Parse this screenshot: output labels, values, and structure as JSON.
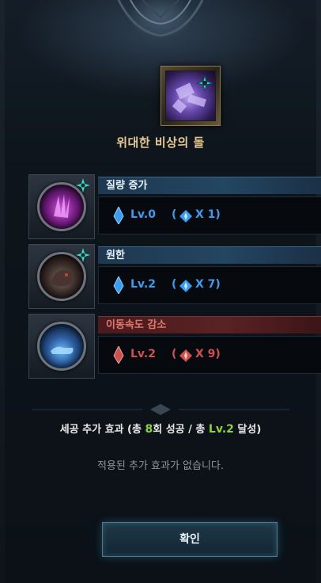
{
  "item": {
    "name": "위대한 비상의 돌"
  },
  "rows": [
    {
      "title": "질량 증가",
      "level": "Lv.0",
      "open_paren": "(",
      "multiplier": "X 1)",
      "color": "#3a9df0",
      "type": "blue",
      "icon": "purple-claw-icon",
      "badge": "sparkle-gem-icon"
    },
    {
      "title": "원한",
      "level": "Lv.2",
      "open_paren": "(",
      "multiplier": "X 7)",
      "color": "#3a9df0",
      "type": "blue",
      "icon": "dark-beast-icon",
      "badge": "sparkle-gem-icon"
    },
    {
      "title": "이동속도 감소",
      "level": "Lv.2",
      "open_paren": "(",
      "multiplier": "X 9)",
      "color": "#d0504c",
      "type": "red",
      "icon": "blue-boot-icon"
    }
  ],
  "summary": {
    "prefix": "세공 추가 효과 (총 ",
    "success_count": "8",
    "middle": "회 성공 / 총 ",
    "level": "Lv.2",
    "suffix": " 달성)"
  },
  "no_effect_text": "적용된 추가 효과가 없습니다.",
  "confirm_label": "확인"
}
